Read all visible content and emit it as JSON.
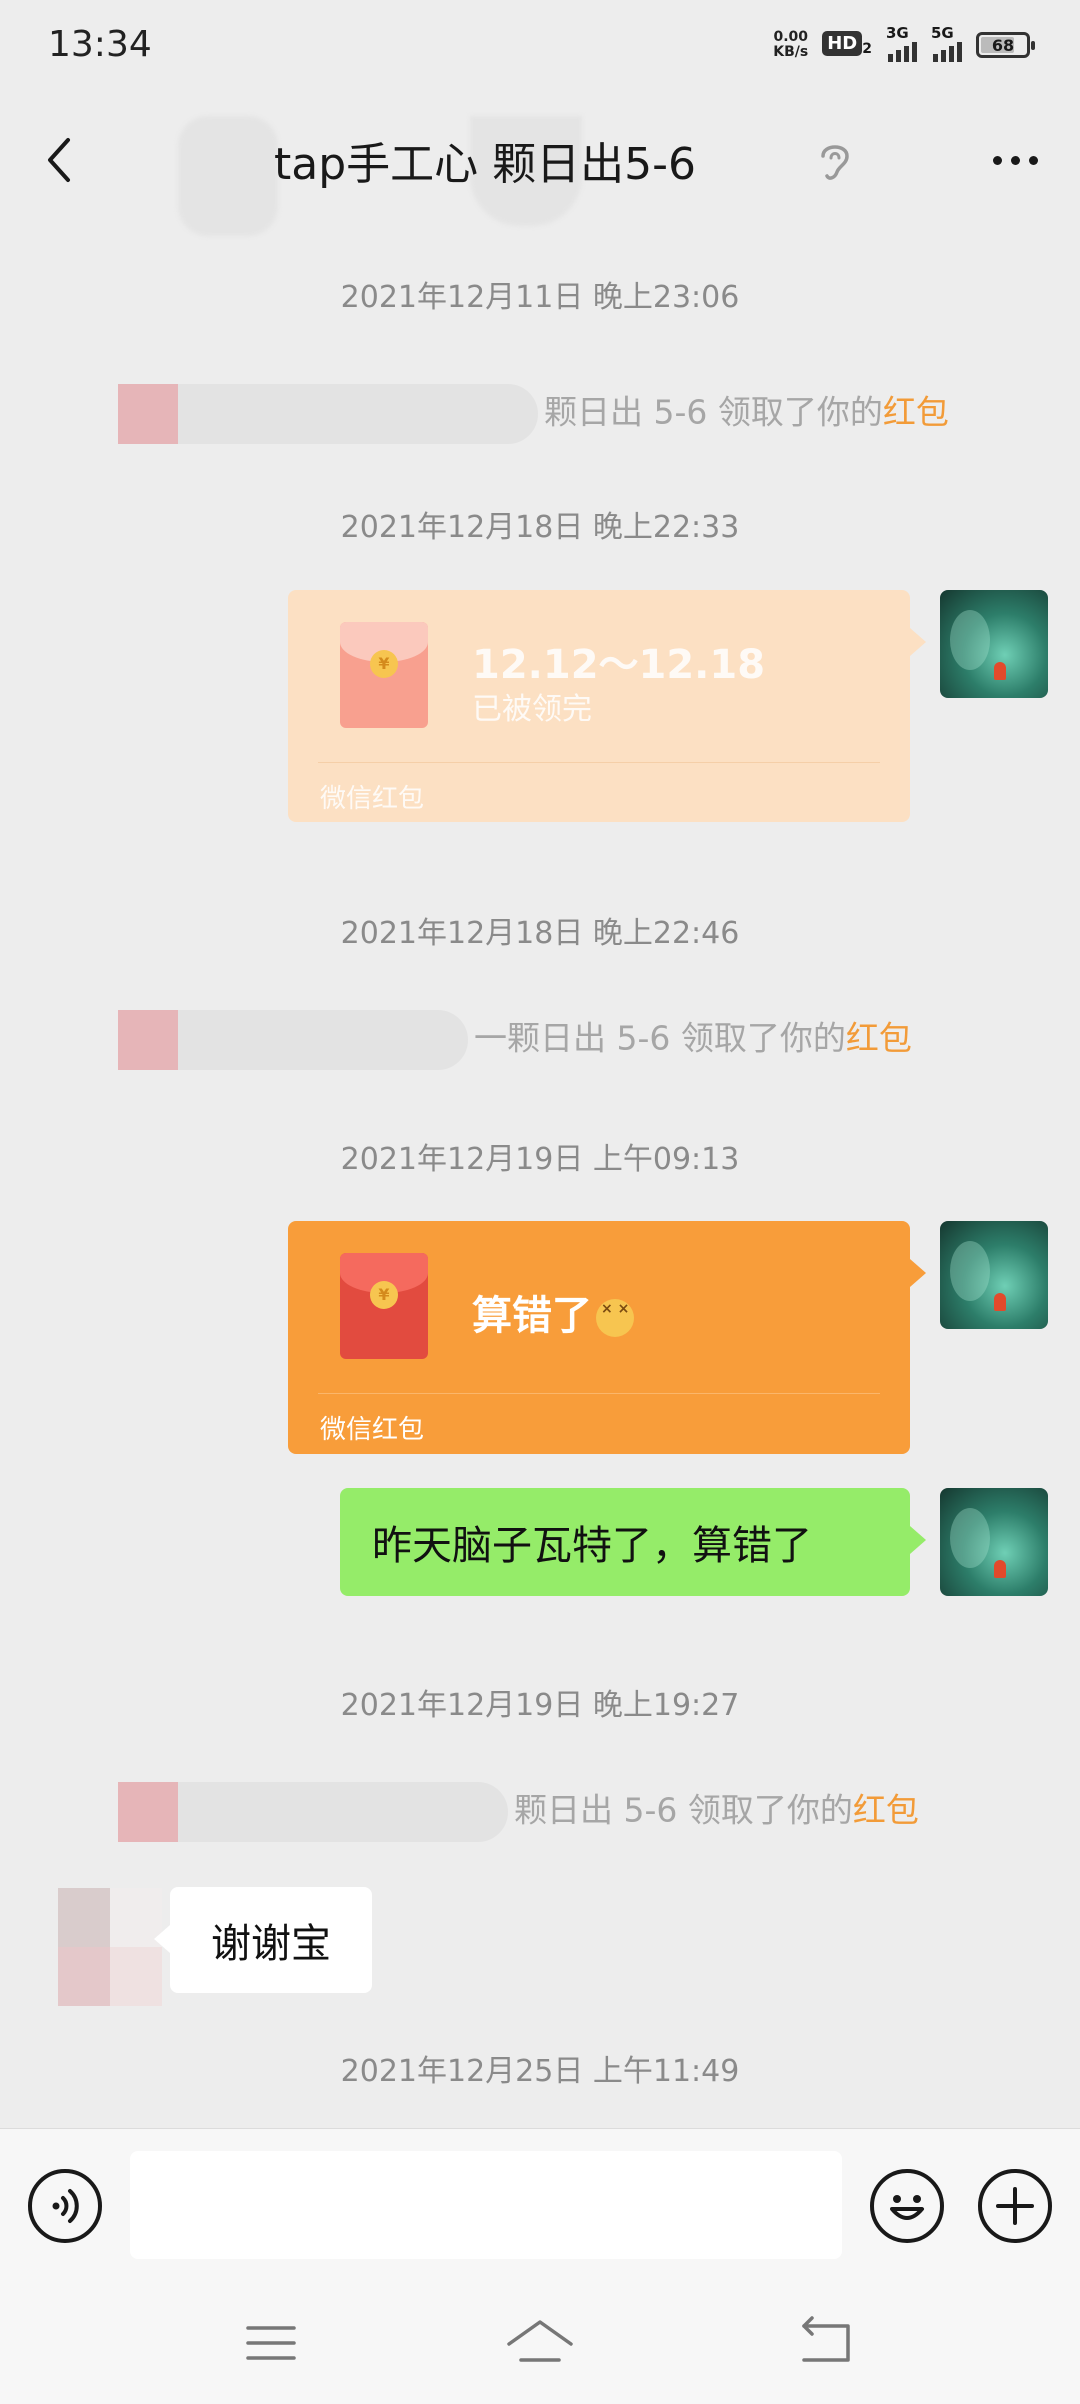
{
  "status_bar": {
    "time": "13:34",
    "net_speed_value": "0.00",
    "net_speed_unit": "KB/s",
    "hd_label": "HD",
    "hd_sub": "2",
    "sim1_label": "3G",
    "sim2_label": "5G",
    "battery": "68"
  },
  "header": {
    "title": "tap手工心 颗日出5-6",
    "back_icon": "chevron-left-icon",
    "ear_icon": "ear-icon",
    "more_icon": "more-dots-icon"
  },
  "messages": {
    "ts1": "2021年12月11日 晚上23:06",
    "sys1_text": "颗日出 5-6 领取了你的",
    "sys1_link": "红包",
    "ts2": "2021年12月18日 晚上22:33",
    "rp1_title": "12.12～12.18",
    "rp1_status": "已被领完",
    "rp1_footer": "微信红包",
    "ts3": "2021年12月18日 晚上22:46",
    "sys2_text": "一颗日出 5-6 领取了你的",
    "sys2_link": "红包",
    "ts4": "2021年12月19日 上午09:13",
    "rp2_title": "算错了",
    "rp2_footer": "微信红包",
    "text_out": "昨天脑子瓦特了，算错了",
    "ts5": "2021年12月19日 晚上19:27",
    "sys3_text": "颗日出 5-6 领取了你的",
    "sys3_link": "红包",
    "text_in": "谢谢宝",
    "ts6": "2021年12月25日 上午11:49"
  },
  "input_bar": {
    "placeholder": "",
    "voice_icon": "voice-icon",
    "emoji_icon": "emoji-icon",
    "plus_icon": "plus-icon"
  },
  "nav_bar": {
    "menu_icon": "menu-icon",
    "home_icon": "home-icon",
    "back_icon": "return-icon"
  },
  "colors": {
    "background": "#ededed",
    "link_orange": "#f29b38",
    "red_packet_orange": "#f89d3a",
    "red_packet_opened": "#fce0c3",
    "bubble_green": "#95ec69"
  }
}
